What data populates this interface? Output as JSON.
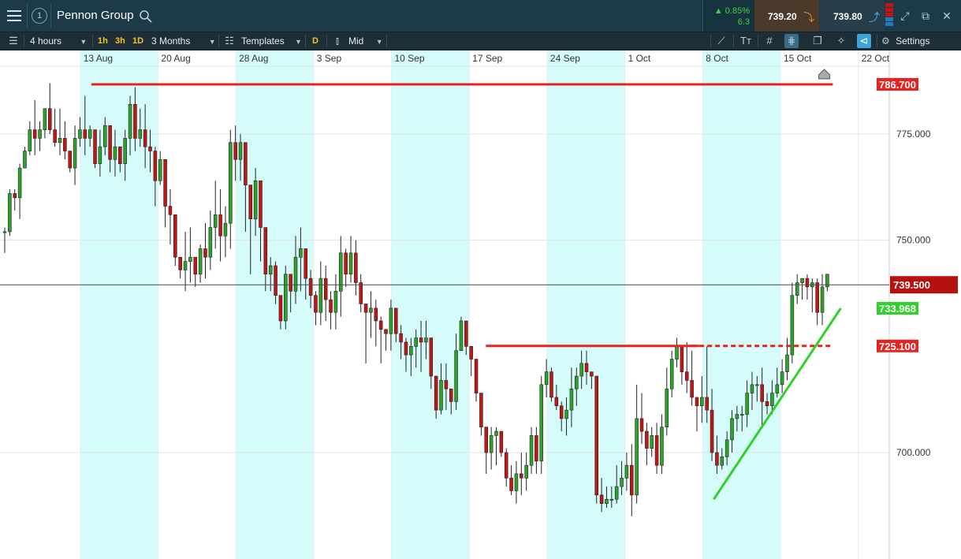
{
  "app": {
    "title": "Pennon Group",
    "window_number": "1"
  },
  "quote": {
    "change_percent": "0.85%",
    "change_points": "6.3",
    "sell": "739.20",
    "buy": "739.80"
  },
  "toolbar": {
    "timeframe": "4 hours",
    "intervals": [
      "1h",
      "3h",
      "1D"
    ],
    "range": "3 Months",
    "templates": "Templates",
    "d_button": "D",
    "price_type": "Mid",
    "settings": "Settings"
  },
  "colors": {
    "bull": "#2aa52a",
    "bear": "#c41414",
    "resistance": "#e8231f",
    "trendline": "#31d02a",
    "header_bg": "#1c3a47",
    "toolbar_bg": "#1e2e36",
    "week_shade": "#d6fbfb"
  },
  "chart_data": {
    "type": "candlestick",
    "timeframe": "4 hours",
    "x_tick_labels": [
      "13 Aug",
      "20 Aug",
      "28 Aug",
      "3 Sep",
      "10 Sep",
      "17 Sep",
      "24 Sep",
      "1 Oct",
      "8 Oct",
      "15 Oct",
      "22 Oct"
    ],
    "y_tick_labels": [
      "775.000",
      "750.000",
      "700.000"
    ],
    "ylim": [
      678,
      799
    ],
    "current_price": 739.5,
    "current_price_label": "739.500",
    "horizontal_lines": [
      {
        "label": "786.700",
        "value": 786.7,
        "style": "solid",
        "from_day": 8,
        "to_day": 74
      },
      {
        "label": "725.100",
        "value": 725.1,
        "style": "solid",
        "from_day": 43.5,
        "to_day": 62
      },
      {
        "label": "725.100",
        "value": 725.1,
        "style": "dashed",
        "from_day": 62,
        "to_day": 74
      }
    ],
    "trendline": {
      "label": "733.968",
      "start": {
        "day": 64,
        "value": 689
      },
      "end": {
        "day": 74,
        "value": 733.968
      }
    },
    "shaded_weeks": [
      [
        7,
        14
      ],
      [
        21,
        28
      ],
      [
        35,
        42
      ],
      [
        49,
        56
      ],
      [
        63,
        70
      ]
    ],
    "candles": [
      [
        752,
        753,
        747,
        752
      ],
      [
        752,
        762,
        751,
        761
      ],
      [
        761,
        762,
        757,
        760
      ],
      [
        760,
        768,
        755,
        767
      ],
      [
        767,
        772,
        767,
        771
      ],
      [
        771,
        778,
        770,
        776
      ],
      [
        776,
        783,
        770,
        774
      ],
      [
        774,
        778,
        771,
        776
      ],
      [
        776,
        781,
        774,
        781
      ],
      [
        781,
        787,
        775,
        776
      ],
      [
        776,
        781,
        772,
        773
      ],
      [
        773,
        781,
        770,
        774
      ],
      [
        774,
        778,
        769,
        771
      ],
      [
        771,
        770,
        766,
        767
      ],
      [
        767,
        777,
        763,
        774
      ],
      [
        774,
        779,
        772,
        776
      ],
      [
        776,
        784,
        770,
        774
      ],
      [
        774,
        777,
        772,
        776
      ],
      [
        776,
        773,
        767,
        768
      ],
      [
        768,
        776,
        765,
        772
      ],
      [
        772,
        779,
        770,
        777
      ],
      [
        777,
        774,
        766,
        769
      ],
      [
        769,
        776,
        765,
        772
      ],
      [
        772,
        771,
        766,
        768
      ],
      [
        768,
        776,
        764,
        774
      ],
      [
        774,
        784,
        770,
        782
      ],
      [
        782,
        786,
        771,
        774
      ],
      [
        774,
        781,
        772,
        776
      ],
      [
        776,
        782,
        767,
        772
      ],
      [
        772,
        776,
        766,
        771
      ],
      [
        771,
        772,
        758,
        764
      ],
      [
        764,
        771,
        763,
        769
      ],
      [
        769,
        764,
        753,
        758
      ],
      [
        758,
        762,
        749,
        756
      ],
      [
        756,
        754,
        744,
        746
      ],
      [
        746,
        746,
        741,
        743
      ],
      [
        743,
        752,
        738,
        745
      ],
      [
        745,
        753,
        740,
        746
      ],
      [
        746,
        744,
        739,
        742
      ],
      [
        742,
        749,
        740,
        748
      ],
      [
        748,
        754,
        741,
        746
      ],
      [
        746,
        757,
        743,
        753
      ],
      [
        753,
        764,
        748,
        756
      ],
      [
        756,
        762,
        745,
        751
      ],
      [
        751,
        758,
        746,
        754
      ],
      [
        754,
        776,
        748,
        773
      ],
      [
        773,
        777,
        764,
        769
      ],
      [
        769,
        775,
        764,
        773
      ],
      [
        773,
        772,
        752,
        763
      ],
      [
        763,
        760,
        742,
        755
      ],
      [
        755,
        767,
        751,
        764
      ],
      [
        764,
        764,
        745,
        753
      ],
      [
        753,
        745,
        738,
        742
      ],
      [
        742,
        746,
        738,
        744
      ],
      [
        744,
        745,
        735,
        737
      ],
      [
        737,
        736,
        729,
        731
      ],
      [
        731,
        744,
        729,
        742
      ],
      [
        742,
        740,
        733,
        738
      ],
      [
        738,
        751,
        735,
        746
      ],
      [
        746,
        753,
        738,
        748
      ],
      [
        748,
        746,
        736,
        741
      ],
      [
        741,
        743,
        734,
        737
      ],
      [
        737,
        738,
        730,
        733
      ],
      [
        733,
        745,
        730,
        741
      ],
      [
        741,
        744,
        731,
        736
      ],
      [
        736,
        738,
        729,
        733
      ],
      [
        733,
        742,
        729,
        738
      ],
      [
        738,
        751,
        732,
        747
      ],
      [
        747,
        748,
        739,
        742
      ],
      [
        742,
        751,
        740,
        747
      ],
      [
        747,
        750,
        737,
        740
      ],
      [
        740,
        742,
        733,
        735
      ],
      [
        735,
        734,
        721,
        733
      ],
      [
        733,
        738,
        727,
        734
      ],
      [
        734,
        736,
        725,
        731
      ],
      [
        731,
        732,
        721,
        729
      ],
      [
        729,
        729,
        724,
        728
      ],
      [
        728,
        736,
        724,
        734
      ],
      [
        734,
        731,
        726,
        728
      ],
      [
        728,
        730,
        722,
        726
      ],
      [
        726,
        727,
        719,
        723
      ],
      [
        723,
        727,
        718,
        725
      ],
      [
        725,
        729,
        720,
        727
      ],
      [
        727,
        731,
        719,
        726
      ],
      [
        726,
        731,
        722,
        727
      ],
      [
        727,
        726,
        715,
        718
      ],
      [
        718,
        718,
        708,
        710
      ],
      [
        710,
        721,
        709,
        717
      ],
      [
        717,
        721,
        710,
        715
      ],
      [
        715,
        714,
        709,
        712
      ],
      [
        712,
        728,
        710,
        724
      ],
      [
        724,
        732,
        725,
        731
      ],
      [
        731,
        731,
        723,
        725
      ],
      [
        725,
        725,
        718,
        722
      ],
      [
        722,
        719,
        712,
        714
      ],
      [
        714,
        713,
        704,
        706
      ],
      [
        706,
        706,
        695,
        700
      ],
      [
        700,
        706,
        696,
        704
      ],
      [
        704,
        706,
        697,
        705
      ],
      [
        705,
        704,
        699,
        700
      ],
      [
        700,
        701,
        692,
        694
      ],
      [
        694,
        697,
        690,
        691
      ],
      [
        691,
        698,
        688,
        695
      ],
      [
        695,
        700,
        690,
        694
      ],
      [
        694,
        700,
        691,
        697
      ],
      [
        697,
        706,
        695,
        704
      ],
      [
        704,
        706,
        695,
        698
      ],
      [
        698,
        718,
        695,
        716
      ],
      [
        716,
        722,
        713,
        719
      ],
      [
        719,
        720,
        712,
        713
      ],
      [
        713,
        716,
        710,
        711
      ],
      [
        711,
        712,
        705,
        708
      ],
      [
        708,
        713,
        704,
        710
      ],
      [
        710,
        720,
        706,
        715
      ],
      [
        715,
        720,
        711,
        718
      ],
      [
        718,
        724,
        715,
        721
      ],
      [
        721,
        724,
        716,
        719
      ],
      [
        719,
        719,
        715,
        718
      ],
      [
        718,
        718,
        688,
        690
      ],
      [
        690,
        694,
        686,
        688
      ],
      [
        688,
        692,
        687,
        689
      ],
      [
        689,
        692,
        687,
        689
      ],
      [
        689,
        697,
        688,
        692
      ],
      [
        692,
        698,
        690,
        694
      ],
      [
        694,
        700,
        691,
        697
      ],
      [
        697,
        702,
        685,
        690
      ],
      [
        690,
        716,
        688,
        708
      ],
      [
        708,
        714,
        702,
        705
      ],
      [
        705,
        707,
        697,
        701
      ],
      [
        701,
        706,
        699,
        704
      ],
      [
        704,
        707,
        695,
        697
      ],
      [
        697,
        709,
        695,
        706
      ],
      [
        706,
        720,
        704,
        715
      ],
      [
        715,
        724,
        713,
        722
      ],
      [
        722,
        727,
        720,
        725
      ],
      [
        725,
        725,
        716,
        719
      ],
      [
        719,
        726,
        714,
        717
      ],
      [
        717,
        724,
        711,
        713
      ],
      [
        713,
        713,
        705,
        711
      ],
      [
        711,
        718,
        707,
        713
      ],
      [
        713,
        725,
        707,
        710
      ],
      [
        710,
        715,
        698,
        700
      ],
      [
        700,
        704,
        695,
        697
      ],
      [
        697,
        701,
        696,
        699
      ],
      [
        699,
        705,
        697,
        703
      ],
      [
        703,
        710,
        700,
        708
      ],
      [
        708,
        711,
        705,
        709
      ],
      [
        709,
        711,
        705,
        709
      ],
      [
        709,
        717,
        706,
        714
      ],
      [
        714,
        719,
        710,
        716
      ],
      [
        716,
        718,
        712,
        716
      ],
      [
        716,
        720,
        706,
        712
      ],
      [
        712,
        714,
        709,
        711
      ],
      [
        711,
        717,
        709,
        714
      ],
      [
        714,
        720,
        713,
        716
      ],
      [
        716,
        722,
        714,
        719
      ],
      [
        719,
        727,
        717,
        723
      ],
      [
        723,
        740,
        721,
        737
      ],
      [
        737,
        742,
        735,
        740
      ],
      [
        740,
        741,
        736,
        741
      ],
      [
        741,
        742,
        736,
        739
      ],
      [
        739,
        741,
        733,
        740
      ],
      [
        740,
        741,
        730,
        733
      ],
      [
        733,
        742,
        730,
        739
      ],
      [
        739,
        742,
        738,
        742
      ]
    ]
  }
}
